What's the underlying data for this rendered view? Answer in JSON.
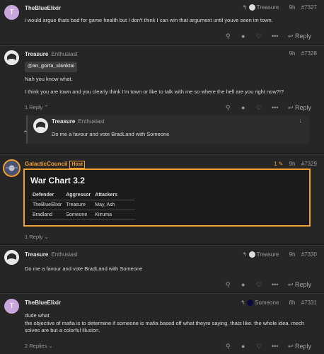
{
  "posts": [
    {
      "username": "TheBlueElixir",
      "reply_to": "Treasure",
      "time": "9h",
      "number": "#7327",
      "avatar_letter": "T",
      "body": "i would argue thats bad for game health but I don't think I can win that argument until youve seen im town.",
      "reply_label": "Reply"
    },
    {
      "username": "Treasure",
      "title": "Enthusiast",
      "time": "9h",
      "number": "#7328",
      "mention": "@an_gorta_slanktai",
      "body_lines": [
        "Nah you know what.",
        "I think you are town and you clearly think I'm town or like to talk with me so where the hell are you right now?!?"
      ],
      "replies_label": "1 Reply",
      "reply_label": "Reply",
      "embed": {
        "username": "Treasure",
        "title": "Enthusiast",
        "body": "Do me a favour and vote BradLand with Someone"
      }
    },
    {
      "username": "GalacticCouncil",
      "badge": "Host",
      "edit_count": "1",
      "time": "9h",
      "number": "#7329",
      "war_title": "War Chart 3.2",
      "table": {
        "headers": [
          "Defender",
          "Aggressor",
          "Attackers"
        ],
        "rows": [
          [
            "TheBlueElixir",
            "Treasure",
            "May, Ash"
          ],
          [
            "Bradland",
            "Someone",
            "Kiiruma"
          ]
        ]
      },
      "replies_label": "1 Reply"
    },
    {
      "username": "Treasure",
      "title": "Enthusiast",
      "reply_to": "Treasure",
      "time": "9h",
      "number": "#7330",
      "body": "Do me a favour and vote BradLand with Someone",
      "reply_label": "Reply"
    },
    {
      "username": "TheBlueElixir",
      "reply_to": "Someone",
      "time": "8h",
      "number": "#7331",
      "avatar_letter": "T",
      "body_lines": [
        "dude what",
        "the objective of mafia is to determine if someone is mafia based off what theyre saying. thats like. the whole idea. mech",
        "solves are but a colorful illusion."
      ],
      "replies_label": "2 Replies",
      "reply_label": "Reply"
    }
  ],
  "icons": {
    "reply_arrow": "reply-arrow-icon",
    "link": "link-icon",
    "user": "user-icon",
    "heart": "heart-icon",
    "more": "more-icon",
    "reply": "reply-icon",
    "chevron": "chevron-icon",
    "edit": "pencil-icon"
  },
  "colors": {
    "background": "#262626",
    "host_accent": "#f0a030",
    "avatar_t": "#c9a7dd"
  }
}
